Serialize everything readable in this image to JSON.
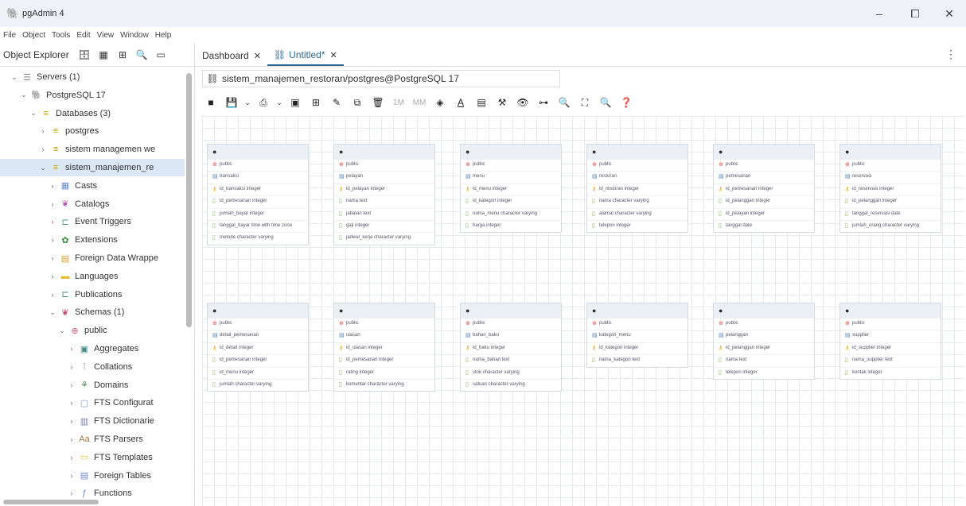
{
  "window": {
    "title": "pgAdmin 4",
    "minimize": "–",
    "maximize": "⧠",
    "close": "✕"
  },
  "menu": [
    "File",
    "Object",
    "Tools",
    "Edit",
    "View",
    "Window",
    "Help"
  ],
  "explorer": {
    "title": "Object Explorer"
  },
  "tree": [
    {
      "label": "Servers (1)",
      "icon": "servers-icon",
      "depth": 0,
      "chev": "⌄"
    },
    {
      "label": "PostgreSQL 17",
      "icon": "elephant-icon",
      "depth": 1,
      "chev": "⌄"
    },
    {
      "label": "Databases (3)",
      "icon": "databases-icon",
      "depth": 2,
      "chev": "⌄"
    },
    {
      "label": "postgres",
      "icon": "database-icon",
      "depth": 3,
      "chev": "›"
    },
    {
      "label": "sistem managemen we",
      "icon": "database-icon",
      "depth": 3,
      "chev": "›"
    },
    {
      "label": "sistem_manajemen_re",
      "icon": "database-icon",
      "depth": 3,
      "chev": "⌄",
      "selected": true
    },
    {
      "label": "Casts",
      "icon": "casts-icon",
      "depth": 4,
      "chev": "›"
    },
    {
      "label": "Catalogs",
      "icon": "catalogs-icon",
      "depth": 4,
      "chev": "›"
    },
    {
      "label": "Event Triggers",
      "icon": "event-triggers-icon",
      "depth": 4,
      "chev": "›"
    },
    {
      "label": "Extensions",
      "icon": "extensions-icon",
      "depth": 4,
      "chev": "›"
    },
    {
      "label": "Foreign Data Wrappe",
      "icon": "foreign-data-wrappers-icon",
      "depth": 4,
      "chev": "›"
    },
    {
      "label": "Languages",
      "icon": "languages-icon",
      "depth": 4,
      "chev": "›"
    },
    {
      "label": "Publications",
      "icon": "publications-icon",
      "depth": 4,
      "chev": "›"
    },
    {
      "label": "Schemas (1)",
      "icon": "schemas-icon",
      "depth": 4,
      "chev": "⌄"
    },
    {
      "label": "public",
      "icon": "schema-icon",
      "depth": 5,
      "chev": "⌄"
    },
    {
      "label": "Aggregates",
      "icon": "aggregates-icon",
      "depth": 6,
      "chev": "›"
    },
    {
      "label": "Collations",
      "icon": "collations-icon",
      "depth": 6,
      "chev": "›"
    },
    {
      "label": "Domains",
      "icon": "domains-icon",
      "depth": 6,
      "chev": "›"
    },
    {
      "label": "FTS Configurat",
      "icon": "fts-config-icon",
      "depth": 6,
      "chev": "›"
    },
    {
      "label": "FTS Dictionarie",
      "icon": "fts-dictionaries-icon",
      "depth": 6,
      "chev": "›"
    },
    {
      "label": "FTS Parsers",
      "icon": "fts-parsers-icon",
      "depth": 6,
      "chev": "›"
    },
    {
      "label": "FTS Templates",
      "icon": "fts-templates-icon",
      "depth": 6,
      "chev": "›"
    },
    {
      "label": "Foreign Tables",
      "icon": "foreign-tables-icon",
      "depth": 6,
      "chev": "›"
    },
    {
      "label": "Functions",
      "icon": "functions-icon",
      "depth": 6,
      "chev": "›"
    }
  ],
  "tabs": [
    {
      "label": "Dashboard",
      "close": "✕",
      "icon": ""
    },
    {
      "label": "Untitled*",
      "close": "✕",
      "icon": "erd-icon",
      "active": true
    }
  ],
  "connection": "sistem_manajemen_restoran/postgres@PostgreSQL 17",
  "toolbar": {
    "one_to_many": "1M",
    "many_to_many": "MM"
  },
  "entities": [
    {
      "schema": "public",
      "table": "transaksi",
      "columns": [
        {
          "kind": "pk",
          "text": "id_transaksi integer"
        },
        {
          "kind": "col",
          "text": "id_pemesanan integer"
        },
        {
          "kind": "col",
          "text": "jumlah_bayar integer"
        },
        {
          "kind": "col",
          "text": "tanggal_bayar time with time zone"
        },
        {
          "kind": "col",
          "text": "metode character varying"
        }
      ]
    },
    {
      "schema": "public",
      "table": "pelayan",
      "columns": [
        {
          "kind": "pk",
          "text": "id_pelayan integer"
        },
        {
          "kind": "col",
          "text": "nama text"
        },
        {
          "kind": "col",
          "text": "jabatan text"
        },
        {
          "kind": "col",
          "text": "gaji integer"
        },
        {
          "kind": "col",
          "text": "jadwal_kerja character varying"
        }
      ]
    },
    {
      "schema": "public",
      "table": "menu",
      "columns": [
        {
          "kind": "pk",
          "text": "id_menu integer"
        },
        {
          "kind": "col",
          "text": "id_kategori integer"
        },
        {
          "kind": "col",
          "text": "nama_menu character varying"
        },
        {
          "kind": "col",
          "text": "harga integer"
        }
      ]
    },
    {
      "schema": "public",
      "table": "restoran",
      "columns": [
        {
          "kind": "pk",
          "text": "id_restoran integer"
        },
        {
          "kind": "col",
          "text": "nama character varying"
        },
        {
          "kind": "col",
          "text": "alamat character varying"
        },
        {
          "kind": "col",
          "text": "telepon integer"
        }
      ]
    },
    {
      "schema": "public",
      "table": "pemesanan",
      "columns": [
        {
          "kind": "pk",
          "text": "id_pemesanan integer"
        },
        {
          "kind": "col",
          "text": "id_pelanggan integer"
        },
        {
          "kind": "col",
          "text": "id_pelayan integer"
        },
        {
          "kind": "col",
          "text": "tanggal date"
        }
      ]
    },
    {
      "schema": "public",
      "table": "reservasi",
      "columns": [
        {
          "kind": "pk",
          "text": "id_reservasi integer"
        },
        {
          "kind": "col",
          "text": "id_pelanggan integer"
        },
        {
          "kind": "col",
          "text": "tanggal_reservasi date"
        },
        {
          "kind": "col",
          "text": "jumlah_orang character varying"
        }
      ]
    },
    {
      "schema": "public",
      "table": "detail_pemesanan",
      "columns": [
        {
          "kind": "pk",
          "text": "id_detail integer"
        },
        {
          "kind": "col",
          "text": "id_pemesanan integer"
        },
        {
          "kind": "col",
          "text": "id_menu integer"
        },
        {
          "kind": "col",
          "text": "jumlah character varying"
        }
      ]
    },
    {
      "schema": "public",
      "table": "ulasan",
      "columns": [
        {
          "kind": "pk",
          "text": "id_ulasan integer"
        },
        {
          "kind": "col",
          "text": "id_pemesanan integer"
        },
        {
          "kind": "col",
          "text": "rating integer"
        },
        {
          "kind": "col",
          "text": "komentar character varying"
        }
      ]
    },
    {
      "schema": "public",
      "table": "bahan_baku",
      "columns": [
        {
          "kind": "pk",
          "text": "id_baku integer"
        },
        {
          "kind": "col",
          "text": "nama_bahan text"
        },
        {
          "kind": "col",
          "text": "stok character varying"
        },
        {
          "kind": "col",
          "text": "satuan character varying"
        }
      ]
    },
    {
      "schema": "public",
      "table": "kategori_menu",
      "columns": [
        {
          "kind": "pk",
          "text": "id_kategori integer"
        },
        {
          "kind": "col",
          "text": "nama_kategori text"
        }
      ]
    },
    {
      "schema": "public",
      "table": "pelanggan",
      "columns": [
        {
          "kind": "pk",
          "text": "id_pelanggan integer"
        },
        {
          "kind": "col",
          "text": "nama text"
        },
        {
          "kind": "col",
          "text": "telepon integer"
        }
      ]
    },
    {
      "schema": "public",
      "table": "supplier",
      "columns": [
        {
          "kind": "pk",
          "text": "id_supplier integer"
        },
        {
          "kind": "col",
          "text": "nama_supplier text"
        },
        {
          "kind": "col",
          "text": "kontak integer"
        }
      ]
    }
  ],
  "colors": {
    "accent": "#326690",
    "selected_bg": "#dbe7f5",
    "grid": "#e6e9ee"
  }
}
